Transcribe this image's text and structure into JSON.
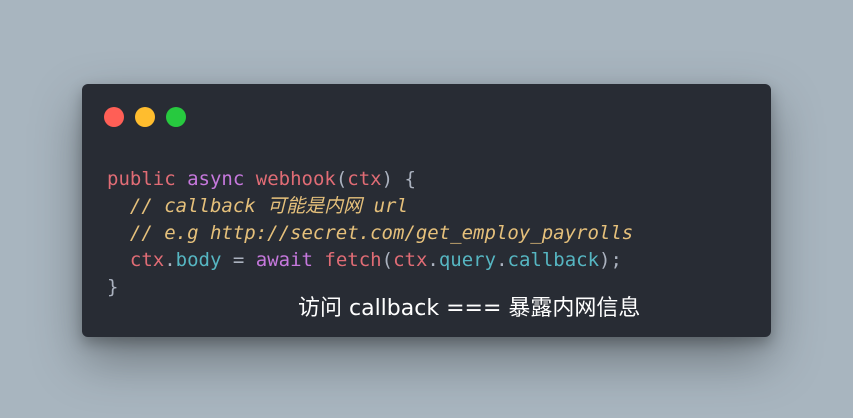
{
  "window": {
    "background": "#282c34",
    "controls": [
      {
        "name": "close",
        "color": "#ff5f56"
      },
      {
        "name": "minimize",
        "color": "#ffbd2e"
      },
      {
        "name": "maximize",
        "color": "#27c93f"
      }
    ]
  },
  "code": {
    "line1": {
      "t1": "public",
      "t2": " ",
      "t3": "async",
      "t4": " ",
      "t5": "webhook",
      "t6": "(",
      "t7": "ctx",
      "t8": ") {"
    },
    "line2": {
      "indent": "  ",
      "comment": "// callback 可能是内网 url"
    },
    "line3": {
      "indent": "  ",
      "comment": "// e.g http://secret.com/get_employ_payrolls"
    },
    "line4": {
      "indent": "  ",
      "t1": "ctx",
      "t2": ".",
      "t3": "body",
      "t4": " = ",
      "t5": "await",
      "t6": " ",
      "t7": "fetch",
      "t8": "(",
      "t9": "ctx",
      "t10": ".",
      "t11": "query",
      "t12": ".",
      "t13": "callback",
      "t14": ");"
    },
    "line5": {
      "t1": "}"
    }
  },
  "caption": "访问 callback === 暴露内网信息",
  "colors": {
    "page_background": "#a8b5bf",
    "keyword_red": "#e06c75",
    "keyword_purple": "#c678dd",
    "property_cyan": "#56b6c2",
    "comment_yellow": "#e5c07b",
    "plain_text": "#abb2bf",
    "caption_text": "#ffffff"
  }
}
